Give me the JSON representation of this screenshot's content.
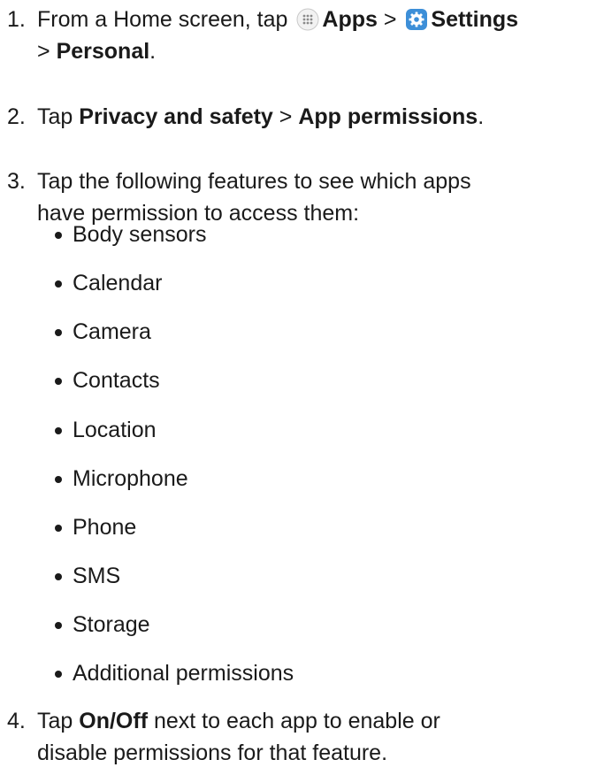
{
  "steps": [
    {
      "num": "1.",
      "line1_a": "From a Home screen, tap",
      "apps_label": "Apps",
      "sep1": ">",
      "settings_label": "Settings",
      "line2_sep": ">",
      "personal_label": "Personal",
      "end": "."
    },
    {
      "num": "2.",
      "a": "Tap",
      "privacy_label": "Privacy and safety",
      "sep": ">",
      "perm_label": "App permissions",
      "end": "."
    },
    {
      "num": "3.",
      "line1": "Tap the following features to see which apps",
      "line2": "have permission to access them:"
    },
    {
      "num": "4.",
      "a": "Tap",
      "onoff_label": "On/Off",
      "line1_rest": "next to each app to enable or",
      "line2": "disable permissions for that feature."
    }
  ],
  "features": [
    "Body sensors",
    "Calendar",
    "Camera",
    "Contacts",
    "Location",
    "Microphone",
    "Phone",
    "SMS",
    "Storage",
    "Additional permissions"
  ],
  "icons": {
    "apps": "apps-grid-icon",
    "settings": "settings-gear-icon",
    "settings_color": "#3d8fd8"
  }
}
